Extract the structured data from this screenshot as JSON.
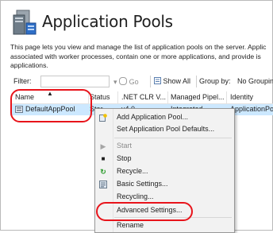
{
  "header": {
    "title": "Application Pools",
    "icon": "application-pools-icon",
    "description_lines": [
      "This page lets you view and manage the list of application pools on the server. Applic",
      "associated with worker processes, contain one or more applications, and provide is",
      "applications."
    ]
  },
  "toolbar": {
    "filter_label": "Filter:",
    "go_label": "Go",
    "show_all_label": "Show All",
    "group_by_label": "Group by:",
    "group_by_value": "No Grouping"
  },
  "table": {
    "columns": [
      "Name",
      "Status",
      ".NET CLR V...",
      "Managed Pipel...",
      "Identity"
    ],
    "rows": [
      {
        "name": "DefaultAppPool",
        "status": "Star",
        "clr": "v4.0",
        "pipeline": "Integrated",
        "identity": "ApplicationPool"
      }
    ]
  },
  "context_menu": {
    "items": [
      {
        "label": "Add Application Pool...",
        "icon": "add-app-pool-icon",
        "disabled": false
      },
      {
        "label": "Set Application Pool Defaults...",
        "icon": "",
        "disabled": false
      },
      {
        "label": "Start",
        "icon": "start-icon",
        "disabled": true
      },
      {
        "label": "Stop",
        "icon": "stop-icon",
        "disabled": false
      },
      {
        "label": "Recycle...",
        "icon": "recycle-icon",
        "disabled": false
      },
      {
        "label": "Basic Settings...",
        "icon": "basic-settings-icon",
        "disabled": false
      },
      {
        "label": "Recycling...",
        "icon": "",
        "disabled": false
      },
      {
        "label": "Advanced Settings...",
        "icon": "",
        "disabled": false
      },
      {
        "label": "Rename",
        "icon": "",
        "disabled": false
      }
    ]
  },
  "colors": {
    "selection": "#cce8ff",
    "highlight_oval": "#e8141b",
    "menu_bg": "#f2f2f2"
  }
}
